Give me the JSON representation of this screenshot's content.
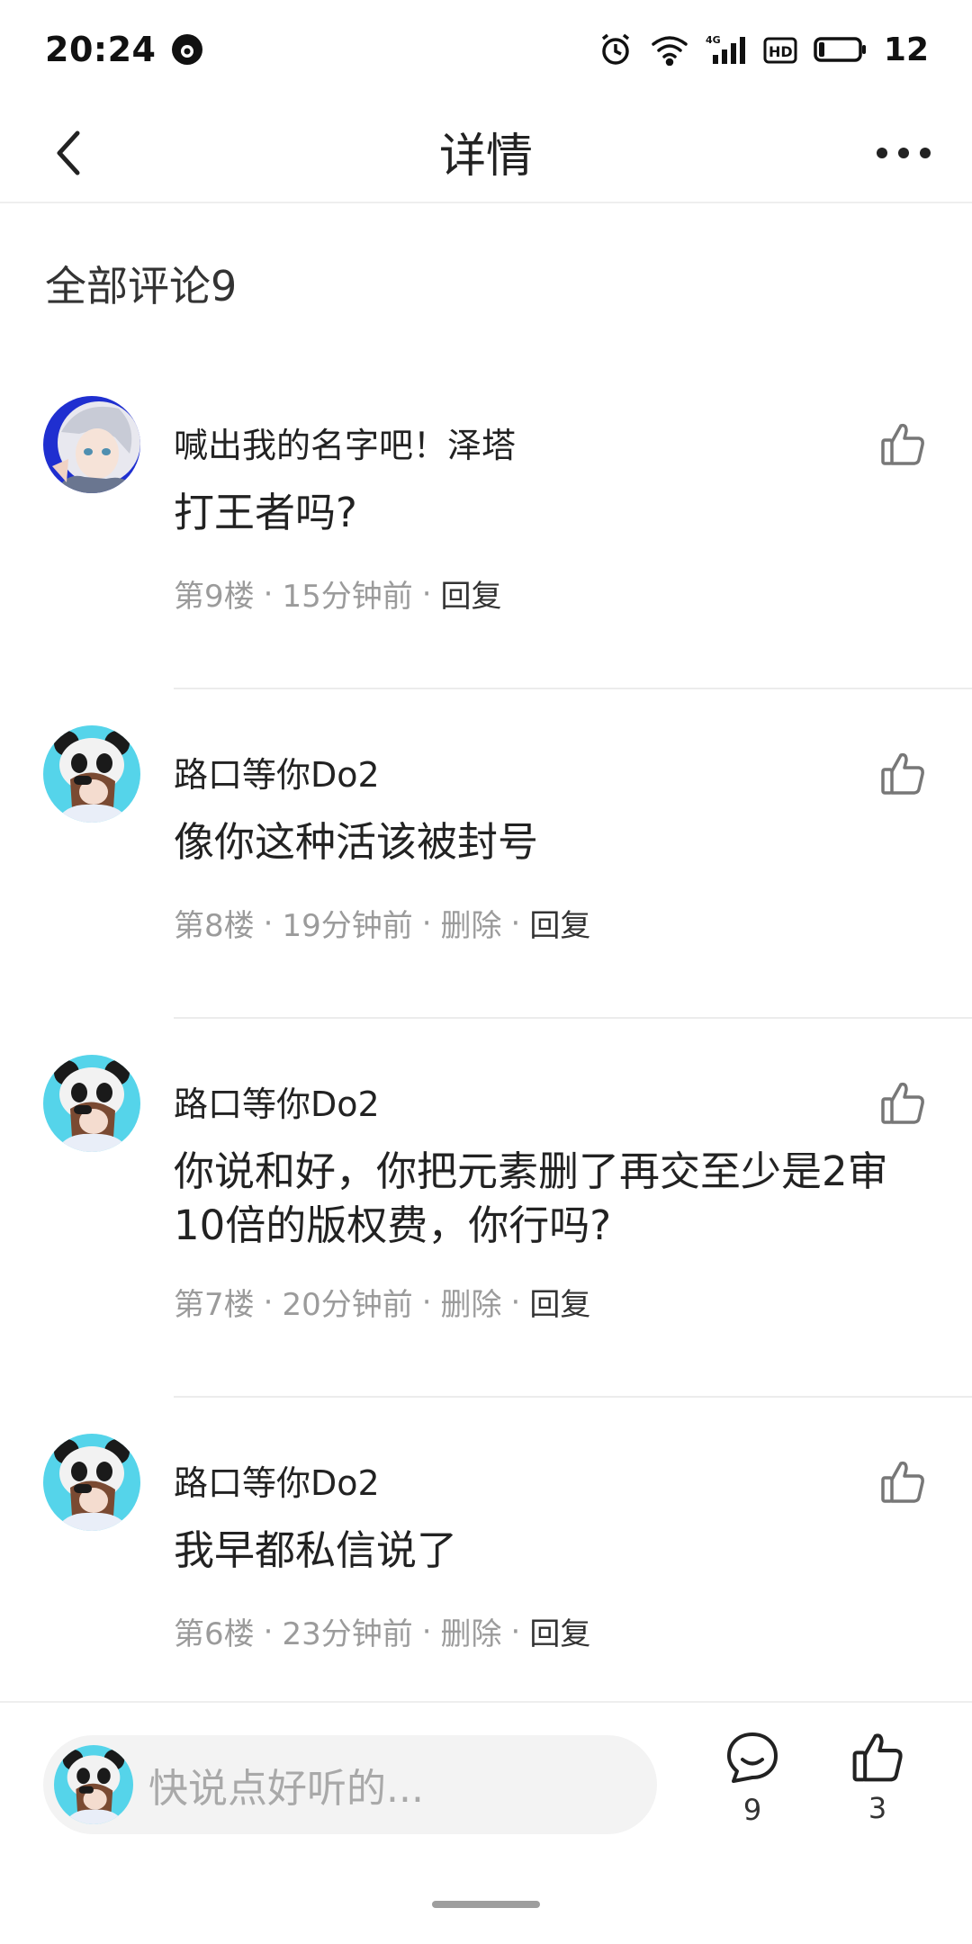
{
  "status_bar": {
    "time": "20:24",
    "battery_level": "12",
    "icons": [
      "notification-app-icon",
      "alarm-icon",
      "wifi-icon",
      "signal-4g-icon",
      "hd-icon",
      "battery-icon"
    ]
  },
  "header": {
    "title": "详情",
    "back_icon": "chevron-left-icon",
    "more_icon": "more-horizontal-icon"
  },
  "section": {
    "heading": "全部评论9"
  },
  "comments": [
    {
      "author": "喊出我的名字吧！泽塔",
      "content": "打王者吗?",
      "floor": "第9楼",
      "time": "15分钟前",
      "delete": "",
      "reply": "回复"
    },
    {
      "author": "路口等你Do2",
      "content": "像你这种活该被封号",
      "floor": "第8楼",
      "time": "19分钟前",
      "delete": "删除",
      "reply": "回复"
    },
    {
      "author": "路口等你Do2",
      "content": "你说和好，你把元素删了再交至少是2审10倍的版权费，你行吗?",
      "floor": "第7楼",
      "time": "20分钟前",
      "delete": "删除",
      "reply": "回复"
    },
    {
      "author": "路口等你Do2",
      "content": "我早都私信说了",
      "floor": "第6楼",
      "time": "23分钟前",
      "delete": "删除",
      "reply": "回复"
    }
  ],
  "bottom_bar": {
    "input_placeholder": "快说点好听的...",
    "comment_count": "9",
    "like_count": "3"
  },
  "colors": {
    "text_primary": "#222222",
    "text_secondary": "#9b9b9b",
    "divider": "#ececec",
    "input_bg": "#f3f3f3"
  }
}
